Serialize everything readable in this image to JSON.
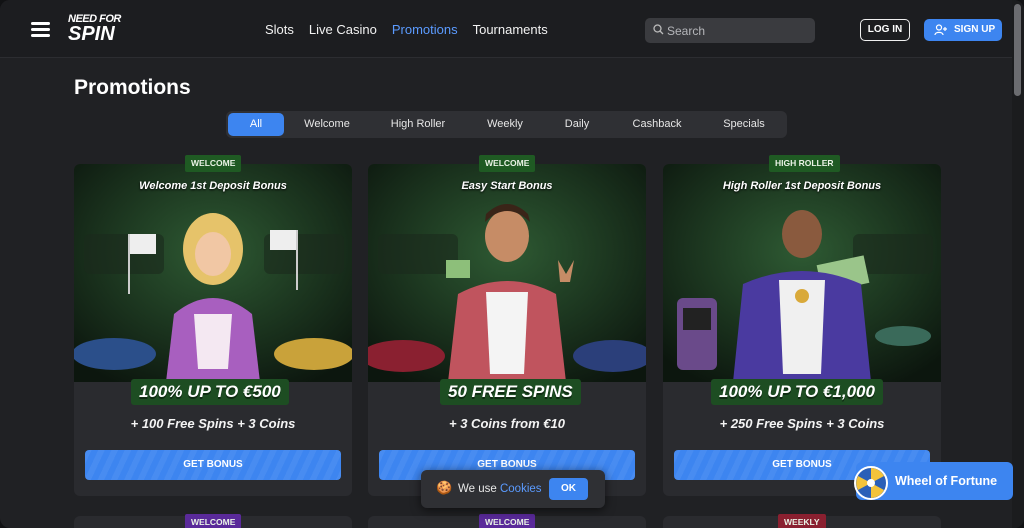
{
  "header": {
    "logo_line1": "NEED FOR",
    "logo_line2": "SPIN",
    "nav": [
      {
        "label": "Slots"
      },
      {
        "label": "Live Casino"
      },
      {
        "label": "Promotions",
        "active": true
      },
      {
        "label": "Tournaments"
      }
    ],
    "search_placeholder": "Search",
    "login_label": "LOG IN",
    "signup_label": "SIGN UP"
  },
  "page_title": "Promotions",
  "tabs": [
    {
      "label": "All",
      "active": true
    },
    {
      "label": "Welcome"
    },
    {
      "label": "High Roller"
    },
    {
      "label": "Weekly"
    },
    {
      "label": "Daily"
    },
    {
      "label": "Cashback"
    },
    {
      "label": "Specials"
    }
  ],
  "cards": [
    {
      "badge": "WELCOME",
      "title": "Welcome 1st Deposit Bonus",
      "headline": "100% UP TO €500",
      "subtitle": "+ 100 Free Spins + 3 Coins",
      "button": "GET BONUS"
    },
    {
      "badge": "WELCOME",
      "title": "Easy Start Bonus",
      "headline": "50 FREE SPINS",
      "subtitle": "+ 3 Coins from €10",
      "button": "GET BONUS"
    },
    {
      "badge": "HIGH ROLLER",
      "title": "High Roller 1st Deposit Bonus",
      "headline": "100% UP TO €1,000",
      "subtitle": "+ 250 Free Spins + 3 Coins",
      "button": "GET BONUS"
    }
  ],
  "next_row_badges": [
    "WELCOME",
    "WELCOME",
    "WEEKLY"
  ],
  "cookie": {
    "text": "We use",
    "link": "Cookies",
    "ok": "OK"
  },
  "wheel_of_fortune": "Wheel of Fortune",
  "colors": {
    "accent": "#3d85f0",
    "badge_green": "#1f5a23",
    "background": "#202124",
    "card": "#2a2b2f"
  }
}
